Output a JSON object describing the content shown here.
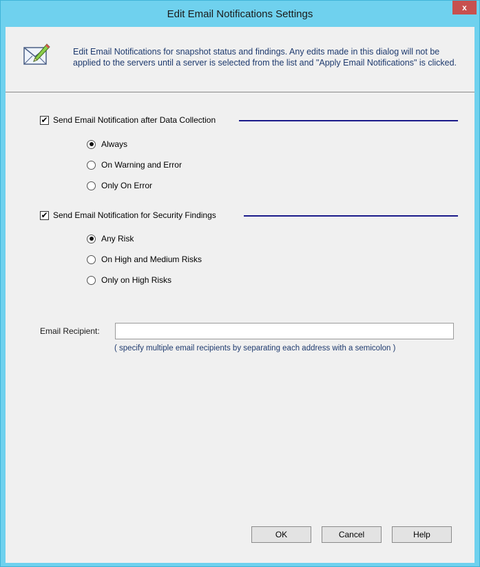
{
  "window": {
    "title": "Edit Email Notifications Settings",
    "close_label": "x"
  },
  "header": {
    "icon": "envelope-pencil-icon",
    "description": "Edit Email Notifications for snapshot status and findings.  Any edits made in this dialog will not be applied to the servers until a server is selected from the list and \"Apply Email Notifications\" is clicked."
  },
  "data_collection": {
    "checked": true,
    "label": "Send Email Notification after Data Collection",
    "options": [
      {
        "label": "Always",
        "selected": true
      },
      {
        "label": "On Warning and Error",
        "selected": false
      },
      {
        "label": "Only On Error",
        "selected": false
      }
    ]
  },
  "security_findings": {
    "checked": true,
    "label": "Send Email Notification for Security Findings",
    "options": [
      {
        "label": "Any Risk",
        "selected": true
      },
      {
        "label": "On High and Medium Risks",
        "selected": false
      },
      {
        "label": "Only on High Risks",
        "selected": false
      }
    ]
  },
  "recipient": {
    "label": "Email Recipient:",
    "value": "",
    "hint": "( specify multiple email recipients by separating each address with a semicolon )"
  },
  "buttons": {
    "ok": "OK",
    "cancel": "Cancel",
    "help": "Help"
  },
  "colors": {
    "title_bar": "#6fd1ee",
    "close_button": "#c7504f",
    "section_line": "#1a1a8a",
    "description_text": "#1e3a6e"
  }
}
